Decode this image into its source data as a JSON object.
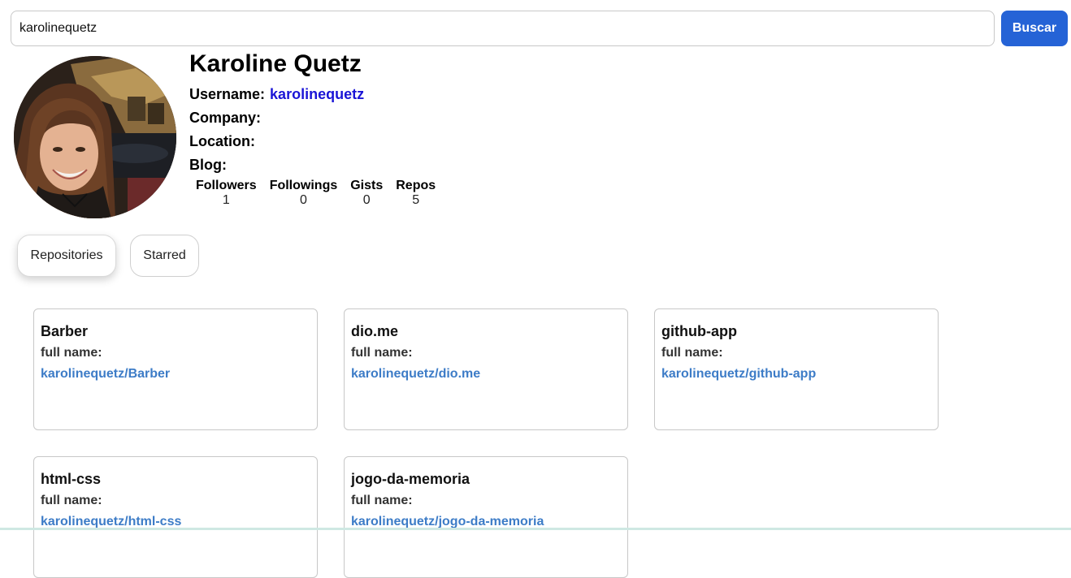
{
  "search": {
    "value": "karolinequetz",
    "button_label": "Buscar"
  },
  "profile": {
    "name": "Karoline Quetz",
    "username_label": "Username:",
    "username": "karolinequetz",
    "company_label": "Company:",
    "location_label": "Location:",
    "blog_label": "Blog:"
  },
  "stats": [
    {
      "label": "Followers",
      "value": "1"
    },
    {
      "label": "Followings",
      "value": "0"
    },
    {
      "label": "Gists",
      "value": "0"
    },
    {
      "label": "Repos",
      "value": "5"
    }
  ],
  "tabs": [
    {
      "label": "Repositories",
      "active": true
    },
    {
      "label": "Starred",
      "active": false
    }
  ],
  "repos": [
    {
      "name": "Barber",
      "full_name_label": "full name:",
      "full_name": "karolinequetz/Barber"
    },
    {
      "name": "dio.me",
      "full_name_label": "full name:",
      "full_name": "karolinequetz/dio.me"
    },
    {
      "name": "github-app",
      "full_name_label": "full name:",
      "full_name": "karolinequetz/github-app"
    },
    {
      "name": "html-css",
      "full_name_label": "full name:",
      "full_name": "karolinequetz/html-css"
    },
    {
      "name": "jogo-da-memoria",
      "full_name_label": "full name:",
      "full_name": "karolinequetz/jogo-da-memoria"
    }
  ],
  "colors": {
    "accent": "#2563d6",
    "username": "#1a14d6",
    "repo_link": "#3d7cc7"
  }
}
